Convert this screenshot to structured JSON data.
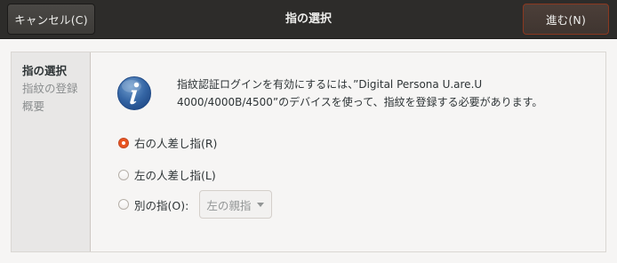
{
  "header": {
    "cancel_label": "キャンセル(C)",
    "title": "指の選択",
    "next_label": "進む(N)"
  },
  "sidebar": {
    "items": [
      {
        "label": "指の選択",
        "active": true
      },
      {
        "label": "指紋の登録",
        "active": false
      },
      {
        "label": "概要",
        "active": false
      }
    ]
  },
  "main": {
    "info_icon": "info-icon",
    "info_text": "指紋認証ログインを有効にするには、”Digital Persona U.are.U 4000/4000B/4500”のデバイスを使って、指紋を登録する必要があります。",
    "options": [
      {
        "label": "右の人差し指(R)",
        "checked": true
      },
      {
        "label": "左の人差し指(L)",
        "checked": false
      },
      {
        "label": "別の指(O):",
        "checked": false
      }
    ],
    "other_finger_select": {
      "value": "左の親指",
      "enabled": false
    }
  },
  "colors": {
    "accent": "#e95420",
    "headerbar": "#2d2c2a",
    "window_bg": "#f6f5f4",
    "sidebar_bg": "#e8e7e6",
    "info_icon_blue": "#3465a4"
  }
}
